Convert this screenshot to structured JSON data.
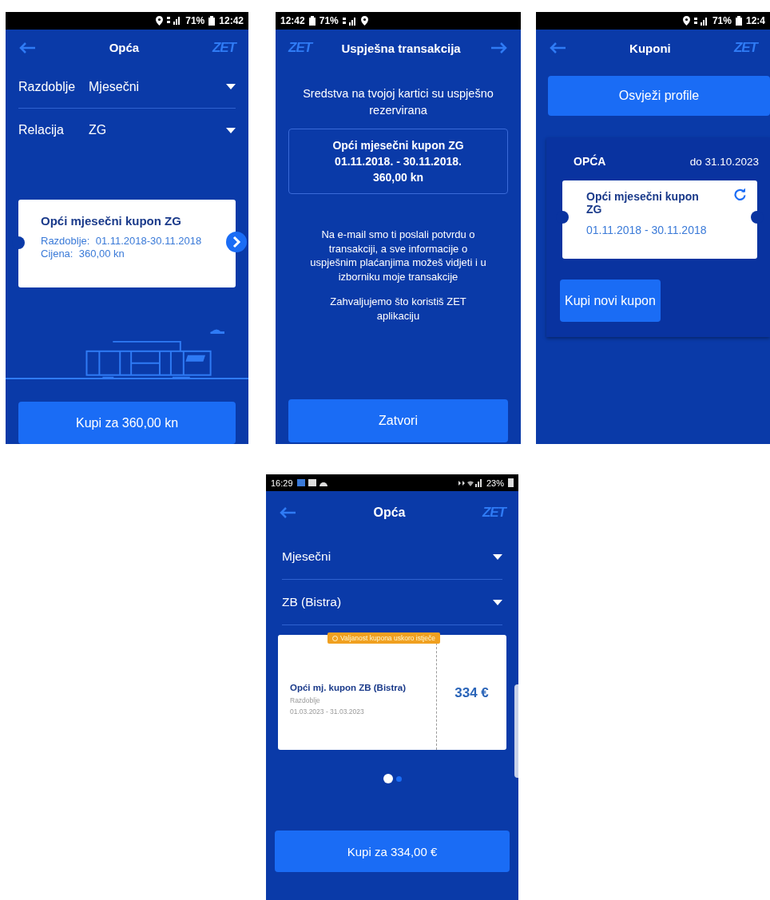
{
  "screens": [
    {
      "kind": "purchase",
      "status_bar": {
        "battery": "71%",
        "time": "12:42"
      },
      "title": "Opća",
      "logo": "ZET",
      "selectors": [
        {
          "label": "Razdoblje",
          "value": "Mjesečni"
        },
        {
          "label": "Relacija",
          "value": "ZG"
        }
      ],
      "coupon": {
        "title": "Opći mjesečni kupon ZG",
        "lines": [
          {
            "label": "Razdoblje:",
            "value": "01.11.2018-30.11.2018"
          },
          {
            "label": "Cijena:",
            "value": "360,00 kn"
          }
        ]
      },
      "buy_button": "Kupi za 360,00 kn"
    },
    {
      "kind": "confirmation",
      "status_bar": {
        "battery": "71%",
        "time": "12:42"
      },
      "title": "Uspješna transakcija",
      "logo": "ZET",
      "message": "Sredstva na tvojoj kartici su uspješno rezervirana",
      "summary": [
        "Opći mjesečni kupon ZG",
        "01.11.2018. - 30.11.2018.",
        "360,00 kn"
      ],
      "notes": [
        "Na e-mail smo ti poslali potvrdu o transakciji, a sve informacije o uspješnim plaćanjima možeš vidjeti i u izborniku moje transakcije",
        "Zahvaljujemo što koristiš ZET aplikaciju"
      ],
      "close_button": "Zatvori"
    },
    {
      "kind": "coupons",
      "status_bar": {
        "battery": "71%",
        "time": "12:4"
      },
      "title": "Kuponi",
      "logo": "ZET",
      "refresh_button": "Osvježi profile",
      "profile": {
        "name": "OPĆA",
        "valid_until": "do 31.10.2023",
        "coupon": {
          "title": "Opći mjesečni kupon ZG",
          "dates": "01.11.2018 - 30.11.2018"
        },
        "buy_button": "Kupi novi kupon"
      }
    },
    {
      "kind": "carousel",
      "status_bar": {
        "time": "16:29",
        "battery": "23%"
      },
      "title": "Opća",
      "logo": "ZET",
      "selectors": [
        {
          "value": "Mjesečni"
        },
        {
          "value": "ZB (Bistra)"
        }
      ],
      "coupon": {
        "warning": "Valjanost kupona uskoro istječe",
        "title": "Opći mj. kupon ZB (Bistra)",
        "period_label": "Razdoblje",
        "dates": "01.03.2023 - 31.03.2023",
        "price": "334 €"
      },
      "pages": [
        {
          "selected": true
        },
        {
          "selected": false
        }
      ],
      "buy_button": "Kupi za 334,00 €"
    }
  ]
}
